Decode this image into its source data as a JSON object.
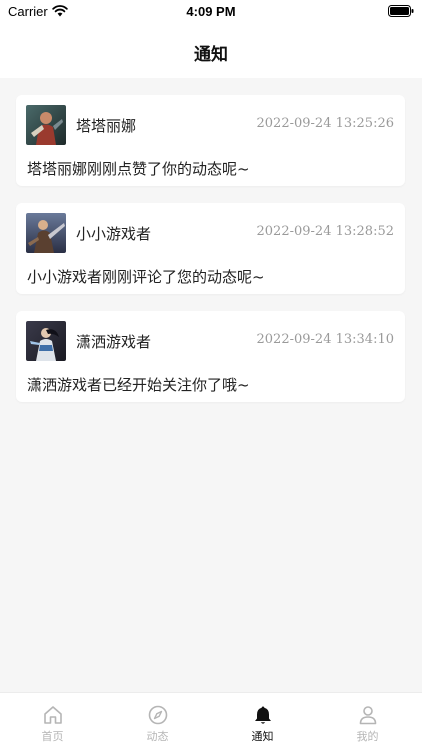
{
  "status_bar": {
    "carrier": "Carrier",
    "time": "4:09 PM"
  },
  "nav": {
    "title": "通知"
  },
  "notifications": [
    {
      "name": "塔塔丽娜",
      "time": "2022-09-24 13:25:26",
      "message": "塔塔丽娜刚刚点赞了你的动态呢~",
      "avatar": "game-character-avatar"
    },
    {
      "name": "小小游戏者",
      "time": "2022-09-24 13:28:52",
      "message": "小小游戏者刚刚评论了您的动态呢~",
      "avatar": "game-character-avatar"
    },
    {
      "name": "潇洒游戏者",
      "time": "2022-09-24 13:34:10",
      "message": "潇洒游戏者已经开始关注你了哦~",
      "avatar": "game-character-avatar"
    }
  ],
  "tabs": [
    {
      "label": "首页",
      "icon": "home-icon",
      "active": false
    },
    {
      "label": "动态",
      "icon": "compass-icon",
      "active": false
    },
    {
      "label": "通知",
      "icon": "bell-icon",
      "active": true
    },
    {
      "label": "我的",
      "icon": "person-icon",
      "active": false
    }
  ],
  "colors": {
    "background": "#f6f6f6",
    "card": "#ffffff",
    "timestamp": "#9a9a9a",
    "tab_inactive": "#b5b5b5",
    "tab_active": "#111111"
  }
}
